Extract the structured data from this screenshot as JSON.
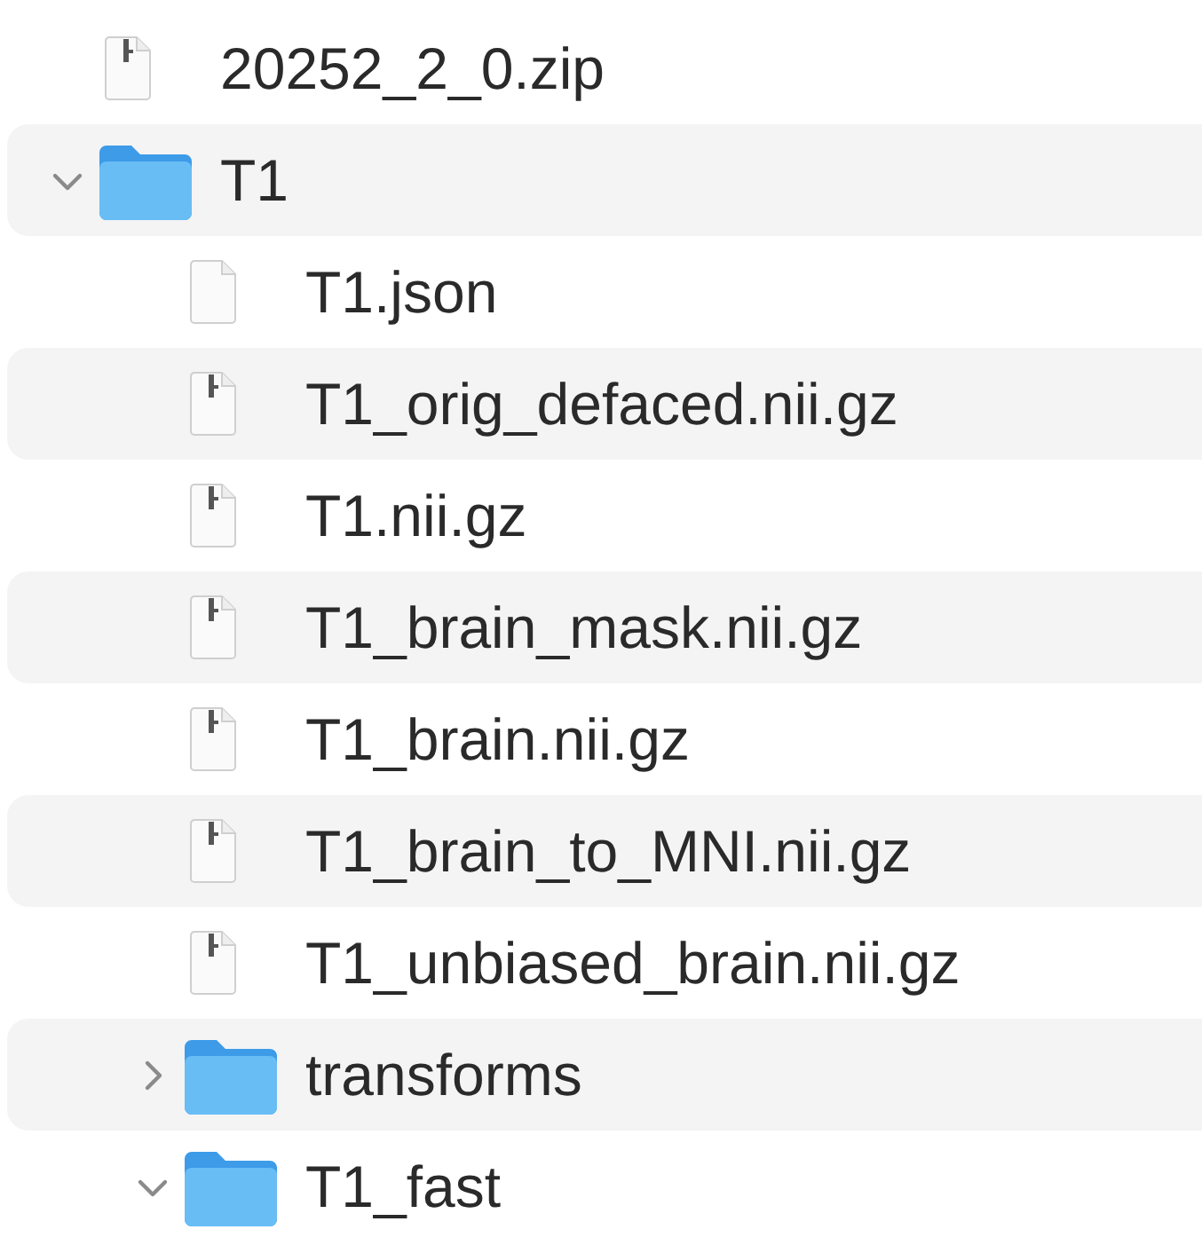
{
  "items": [
    {
      "name": "20252_2_0.zip",
      "kind": "archive"
    },
    {
      "name": "T1",
      "kind": "folder",
      "expanded": true,
      "children": [
        {
          "name": "T1.json",
          "kind": "document"
        },
        {
          "name": "T1_orig_defaced.nii.gz",
          "kind": "archive"
        },
        {
          "name": "T1.nii.gz",
          "kind": "archive"
        },
        {
          "name": "T1_brain_mask.nii.gz",
          "kind": "archive"
        },
        {
          "name": "T1_brain.nii.gz",
          "kind": "archive"
        },
        {
          "name": "T1_brain_to_MNI.nii.gz",
          "kind": "archive"
        },
        {
          "name": "T1_unbiased_brain.nii.gz",
          "kind": "archive"
        },
        {
          "name": "transforms",
          "kind": "folder",
          "expanded": false
        },
        {
          "name": "T1_fast",
          "kind": "folder",
          "expanded": true
        }
      ]
    }
  ]
}
